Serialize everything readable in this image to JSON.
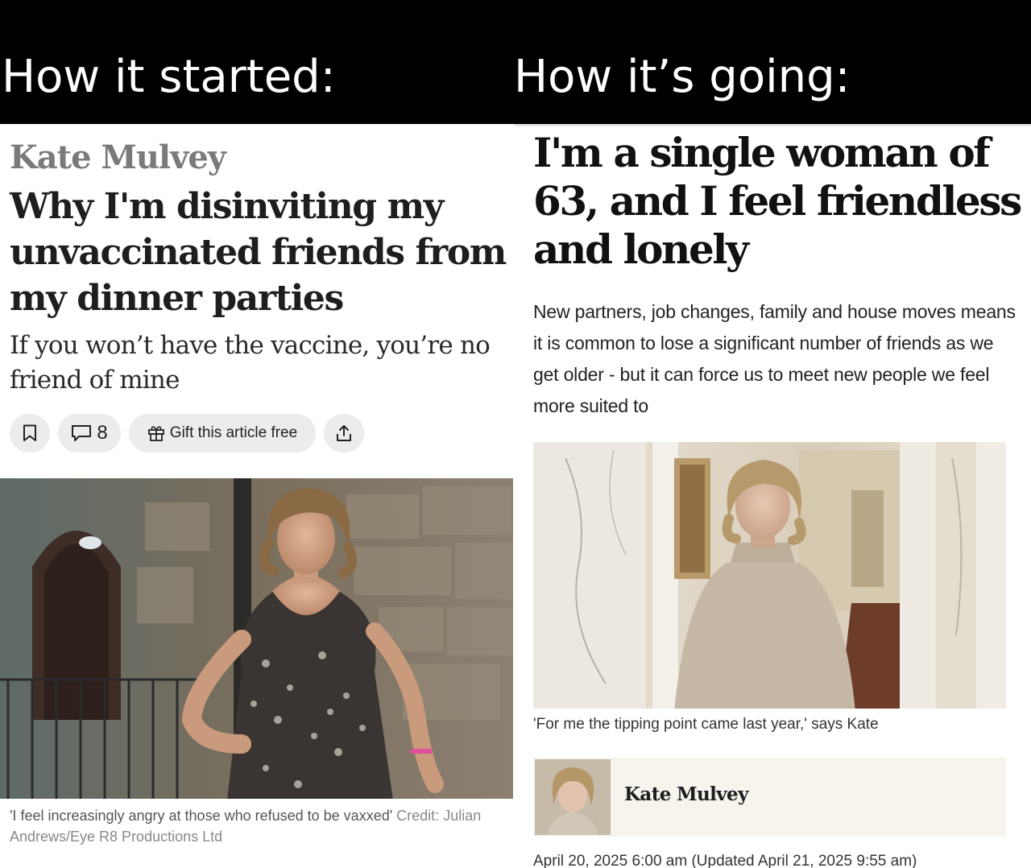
{
  "captions": {
    "left": "How it started:",
    "right": "How it’s going:"
  },
  "left_article": {
    "author": "Kate Mulvey",
    "headline": "Why I'm disinviting my unvaccinated friends from my dinner parties",
    "standfirst": "If you won’t have the vaccine, you’re no friend of mine",
    "actions": {
      "comment_count": "8",
      "gift_label": "Gift this article free"
    },
    "photo_caption": "'I feel increasingly angry at those who refused to be vaxxed'",
    "photo_credit": "Credit: Julian Andrews/Eye R8 Productions Ltd"
  },
  "right_article": {
    "headline": "I'm a single woman of 63, and I feel friendless and lonely",
    "standfirst": "New partners, job changes, family and house moves means it is common to lose a significant number of friends as we get older - but it can force us to meet new people we feel more suited to",
    "photo_caption": "'For me the tipping point came last year,' says Kate",
    "author": "Kate Mulvey",
    "dateline": "April 20, 2025 6:00 am (Updated April 21, 2025 9:55 am)"
  },
  "icons": [
    "bookmark-icon",
    "comment-icon",
    "gift-icon",
    "share-icon"
  ],
  "colors": {
    "caption_bar": "#000000",
    "author_grey": "#7a7a7a",
    "pill_bg": "#ececec",
    "author_box_bg": "#f7f4ee"
  }
}
